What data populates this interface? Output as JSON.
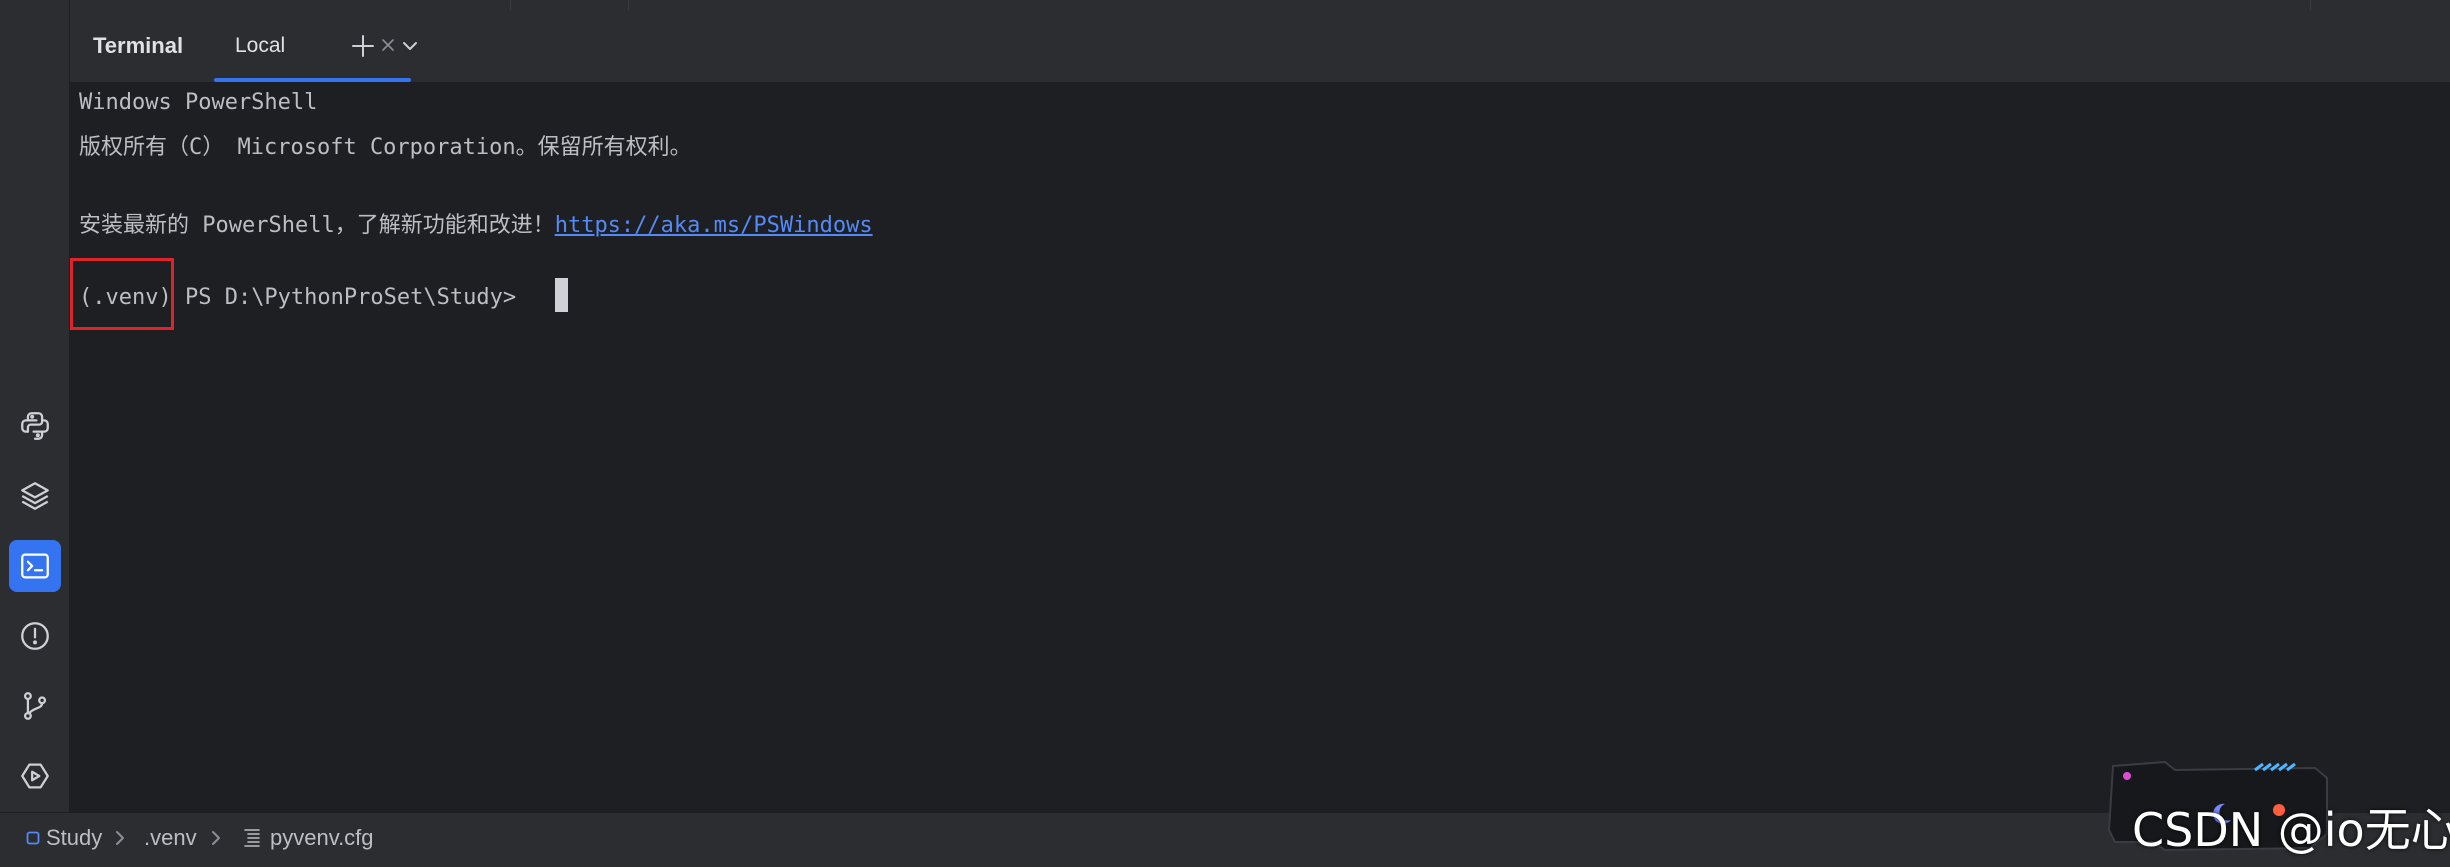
{
  "tool_window": {
    "title": "Terminal",
    "tab_label": "Local"
  },
  "terminal": {
    "lines": [
      "Windows PowerShell",
      "版权所有（C） Microsoft Corporation。保留所有权利。",
      "",
      "安装最新的 PowerShell，了解新功能和改进！",
      "",
      ""
    ],
    "install_link": "https://aka.ms/PSWindows",
    "venv_prefix": "(.venv)",
    "prompt": " PS D:\\PythonProSet\\Study> "
  },
  "left_toolbar": {
    "items": [
      {
        "icon": "python-console-icon",
        "active": false
      },
      {
        "icon": "layers-icon",
        "active": false
      },
      {
        "icon": "terminal-icon",
        "active": true
      },
      {
        "icon": "problems-icon",
        "active": false
      },
      {
        "icon": "git-icon",
        "active": false
      },
      {
        "icon": "services-icon",
        "active": false
      }
    ]
  },
  "breadcrumb": {
    "items": [
      "Study",
      ".venv",
      "pyvenv.cfg"
    ]
  },
  "watermark": {
    "text": "CSDN @io无心"
  },
  "colors": {
    "accent": "#3574f0",
    "link": "#548af7",
    "highlight": "#e0232b"
  }
}
